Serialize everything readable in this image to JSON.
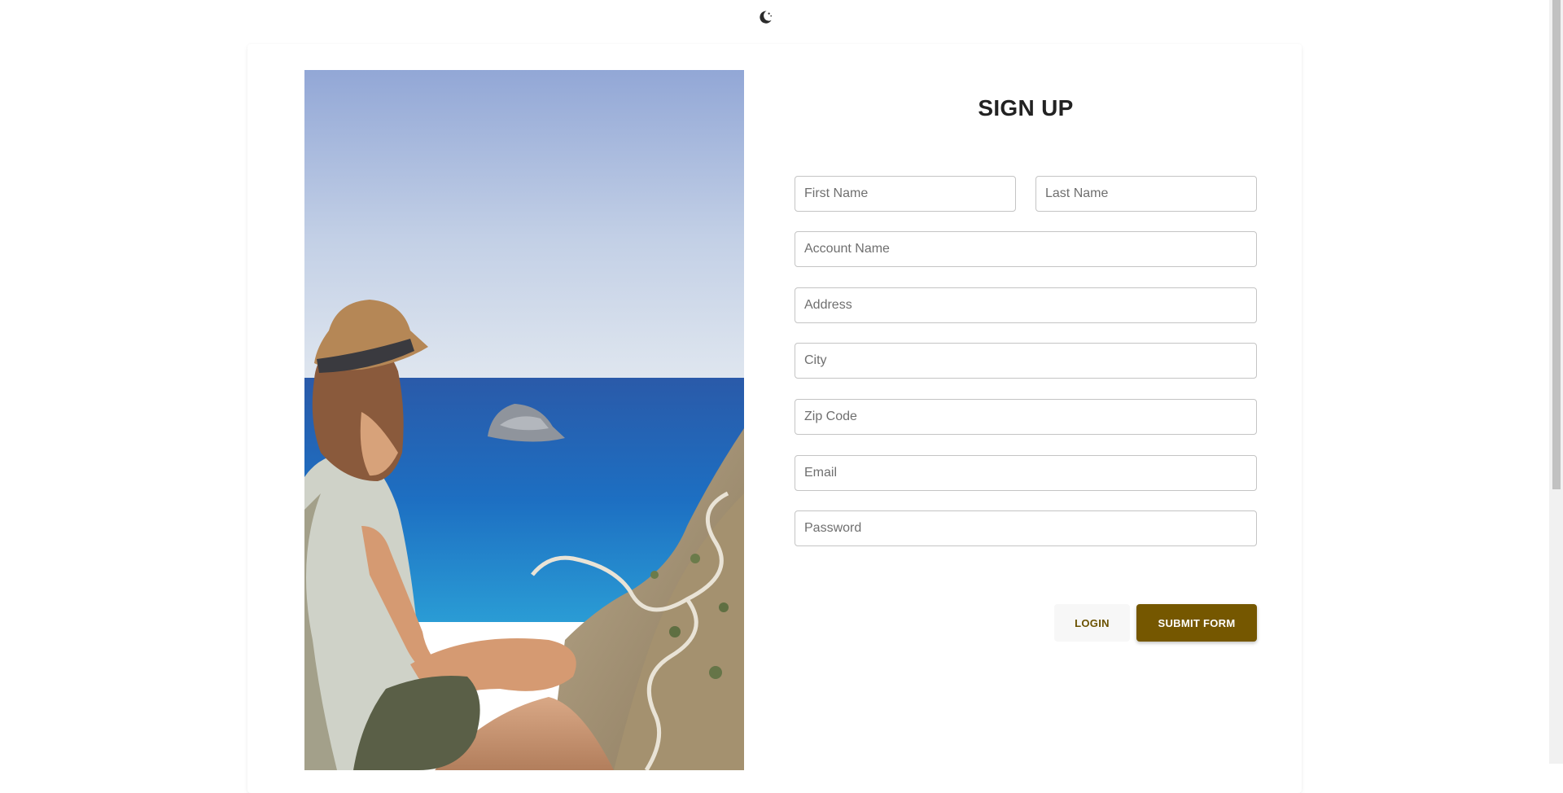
{
  "header": {
    "theme_toggle_icon": "moon-icon"
  },
  "signup": {
    "title": "SIGN UP",
    "fields": {
      "first_name": {
        "placeholder": "First Name",
        "value": ""
      },
      "last_name": {
        "placeholder": "Last Name",
        "value": ""
      },
      "account_name": {
        "placeholder": "Account Name",
        "value": ""
      },
      "address": {
        "placeholder": "Address",
        "value": ""
      },
      "city": {
        "placeholder": "City",
        "value": ""
      },
      "zip_code": {
        "placeholder": "Zip Code",
        "value": ""
      },
      "email": {
        "placeholder": "Email",
        "value": ""
      },
      "password": {
        "placeholder": "Password",
        "value": ""
      }
    },
    "buttons": {
      "login": "LOGIN",
      "submit": "SUBMIT FORM"
    }
  },
  "colors": {
    "accent": "#755700",
    "login_text": "#6b5200",
    "field_border": "#c4c4c4"
  }
}
